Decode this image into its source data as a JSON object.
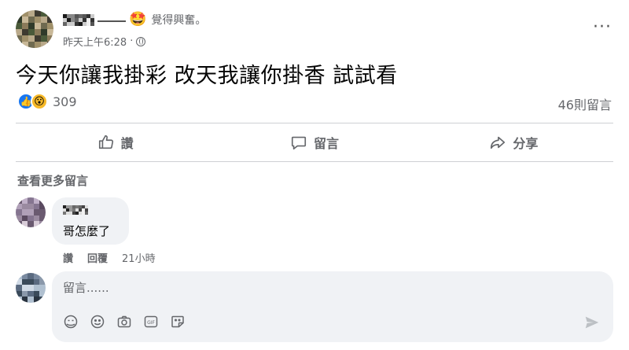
{
  "post": {
    "author_suffix": "——",
    "feeling_emoji": "🤩",
    "feeling": "覺得興奮。",
    "timestamp": "昨天上午6:28",
    "privacy_dot": "·",
    "text": "今天你讓我掛彩 改天我讓你掛香 試試看",
    "more_label": "···"
  },
  "reactions": {
    "like_icon": "👍",
    "wow_icon": "😮",
    "count": "309",
    "comments_count": "46則留言"
  },
  "actions": {
    "like": "讚",
    "comment": "留言",
    "share": "分享"
  },
  "comments": {
    "view_more": "查看更多留言",
    "items": [
      {
        "text": "哥怎麼了",
        "like": "讚",
        "reply": "回覆",
        "time": "21小時"
      }
    ]
  },
  "composer": {
    "placeholder": "留言......"
  },
  "colors": {
    "brand_blue": "#1877f2",
    "secondary_text": "#65676b",
    "bubble_bg": "#f0f2f5"
  }
}
